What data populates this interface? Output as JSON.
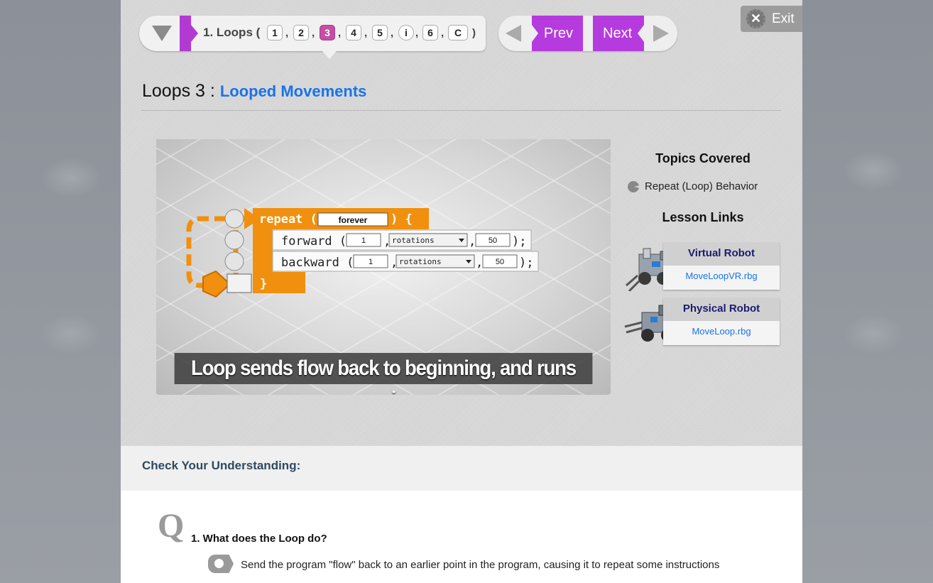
{
  "nav": {
    "lesson_title": "1. Loops (",
    "closing": ")",
    "pages": [
      "1",
      "2",
      "3",
      "4",
      "5",
      "i",
      "6",
      "C"
    ],
    "active_page": "3",
    "prev_label": "Prev",
    "next_label": "Next",
    "exit_label": "Exit"
  },
  "heading": {
    "main": "Loops 3 :",
    "sub": "Looped Movements"
  },
  "video": {
    "caption": "Loop sends flow back to beginning, and runs again",
    "code": {
      "repeat_keyword": "repeat (",
      "repeat_value": "forever",
      "repeat_close": ") {",
      "forward_keyword": "forward (",
      "backward_keyword": "backward (",
      "amount": "1",
      "unit": "rotations",
      "speed": "50",
      "line_end": ");",
      "close_brace": "}"
    }
  },
  "sidebar": {
    "topics_title": "Topics Covered",
    "topics": [
      "Repeat (Loop) Behavior"
    ],
    "links_title": "Lesson Links",
    "links": [
      {
        "header": "Virtual Robot",
        "file": "MoveLoopVR.rbg"
      },
      {
        "header": "Physical Robot",
        "file": "MoveLoop.rbg"
      }
    ]
  },
  "check": {
    "title": "Check Your Understanding:",
    "question": "1. What does the Loop do?",
    "answer": "Send the program \"flow\" back to an earlier point in the program, causing it to repeat some instructions"
  },
  "colors": {
    "accent_purple": "#b63bde",
    "active_pill": "#c64ea7",
    "link_blue": "#1a73e8",
    "code_orange": "#f0900e"
  }
}
